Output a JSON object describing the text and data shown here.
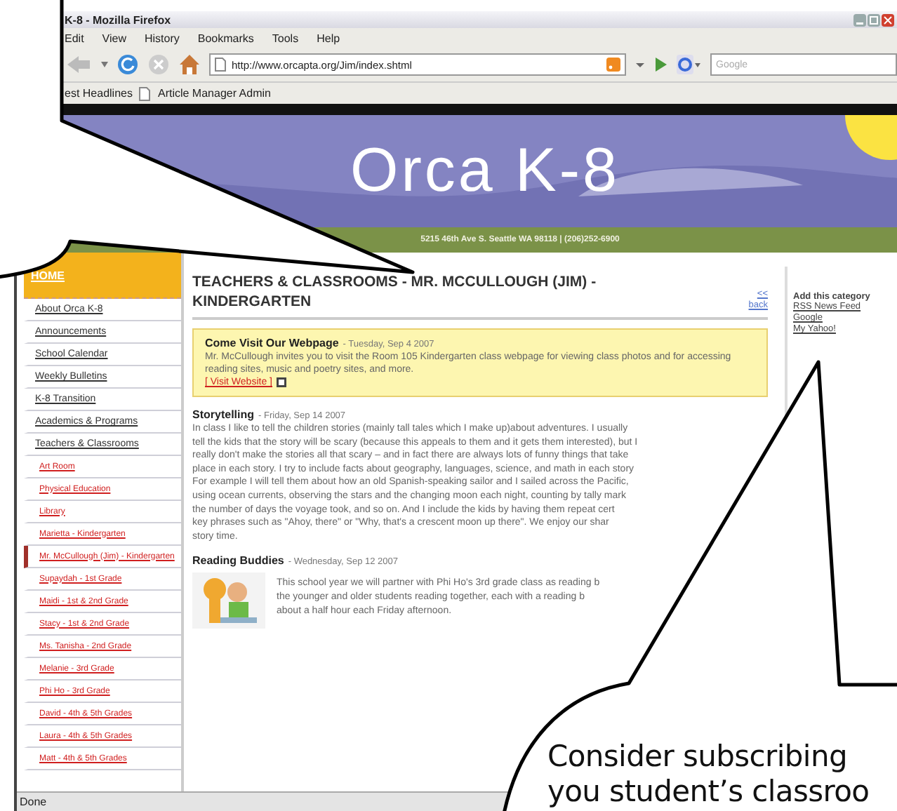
{
  "window": {
    "title": "K-8 - Mozilla Firefox"
  },
  "menu": [
    "Edit",
    "View",
    "History",
    "Bookmarks",
    "Tools",
    "Help"
  ],
  "address_bar": {
    "value": "http://www.orcapta.org/Jim/index.shtml"
  },
  "search": {
    "placeholder": "Google"
  },
  "bookmarks": [
    "est Headlines",
    "Article Manager Admin"
  ],
  "banner": {
    "title": "Orca K-8",
    "address": "5215 46th Ave S. Seattle WA 98118 | (206)252-6900"
  },
  "sidebar": {
    "home": "HOME",
    "items": [
      {
        "label": "About Orca K-8",
        "selected": false
      },
      {
        "label": "Announcements",
        "selected": false
      },
      {
        "label": "School Calendar",
        "selected": false
      },
      {
        "label": "Weekly Bulletins",
        "selected": false
      },
      {
        "label": "K-8 Transition",
        "selected": false
      },
      {
        "label": "Academics & Programs",
        "selected": false
      },
      {
        "label": "Teachers & Classrooms",
        "selected": false,
        "children": [
          {
            "label": "Art Room",
            "selected": false
          },
          {
            "label": "Physical Education",
            "selected": false
          },
          {
            "label": "Library",
            "selected": false
          },
          {
            "label": "Marietta - Kindergarten",
            "selected": false
          },
          {
            "label": "Mr. McCullough (Jim) - Kindergarten",
            "selected": true
          },
          {
            "label": "Supaydah - 1st Grade",
            "selected": false
          },
          {
            "label": "Maidi - 1st & 2nd Grade",
            "selected": false
          },
          {
            "label": "Stacy - 1st & 2nd Grade",
            "selected": false
          },
          {
            "label": "Ms. Tanisha - 2nd Grade",
            "selected": false
          },
          {
            "label": "Melanie - 3rd Grade",
            "selected": false
          },
          {
            "label": "Phi Ho - 3rd Grade",
            "selected": false
          },
          {
            "label": "David - 4th & 5th Grades",
            "selected": false
          },
          {
            "label": "Laura - 4th & 5th Grades",
            "selected": false
          },
          {
            "label": "Matt - 4th & 5th Grades",
            "selected": false
          }
        ]
      }
    ]
  },
  "article": {
    "heading": "TEACHERS & CLASSROOMS - MR. MCCULLOUGH (JIM) - KINDERGARTEN",
    "back_link": "<< back",
    "featured": {
      "title": "Come Visit Our Webpage",
      "date": "- Tuesday, Sep 4 2007",
      "body": "Mr. McCullough invites you to visit the Room 105 Kindergarten class webpage for viewing class photos and for accessing reading sites, music and poetry sites, and more.",
      "link": "[ Visit Website ]"
    },
    "posts": [
      {
        "kind": "text",
        "title": "Storytelling",
        "date": "- Friday, Sep 14 2007",
        "lines": [
          "In class I like to tell the children stories (mainly tall tales which I make up)about adventures. I usually",
          "tell the kids that the story will be scary (because this appeals to them and it gets them interested), but I",
          "really don't make the stories all that scary – and in fact there are always lots of funny things that take",
          "place in each story. I try to include facts about geography, languages, science, and math in each story",
          "For example I will tell them about how an old Spanish-speaking sailor and I sailed across the Pacific,",
          "using ocean currents, observing the stars and the changing moon each night, counting by tally mark",
          "the number of days the voyage took, and so on. And I include the kids by having them repeat cert",
          "key phrases such as \"Ahoy, there\" or \"Why, that's a crescent moon up there\". We enjoy our shar",
          "story time."
        ]
      },
      {
        "kind": "image",
        "title": "Reading Buddies",
        "date": "- Wednesday, Sep 12 2007",
        "lines": [
          "This school year we will partner with Phi Ho's 3rd grade class as reading b",
          "the younger and older students reading together, each with a reading b",
          "about a half hour each Friday afternoon."
        ]
      }
    ]
  },
  "right_panel": {
    "title": "Add this category",
    "links": [
      "RSS News Feed",
      "Google",
      "My Yahoo!"
    ]
  },
  "status_bar": "Done",
  "callout": {
    "lines": [
      "Consider subscribing",
      "you student’s classroo"
    ]
  }
}
